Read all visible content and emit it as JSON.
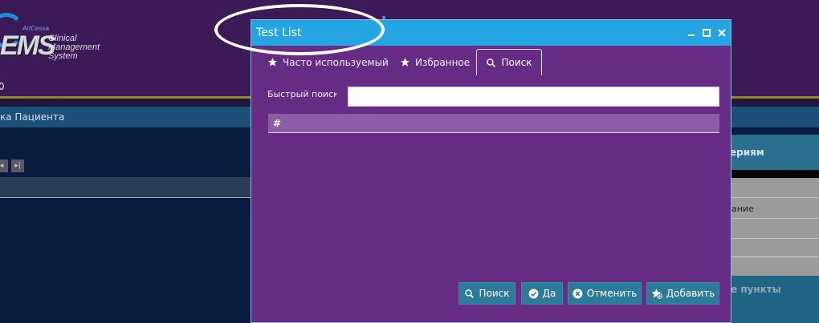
{
  "app": {
    "logo_mark": "EMS",
    "logo_brand": "ArtCessa",
    "logo_lines": [
      "Clinical",
      "Management",
      "System"
    ],
    "version_fragment": "0",
    "left_tab_label": "ка Пациента",
    "right_panel_label": "ериям",
    "right_list_item": "ание",
    "right_footer_label": "е пункты"
  },
  "dialog": {
    "title": "Test List",
    "tabs": [
      {
        "label": "Часто используемый",
        "icon": "star-icon",
        "active": false
      },
      {
        "label": "Избранное",
        "icon": "star-icon",
        "active": false
      },
      {
        "label": "Поиск",
        "icon": "search-icon",
        "active": true
      }
    ],
    "quick_search_label": "Быстрый поиск",
    "quick_search_value": "",
    "grid_columns": [
      "#"
    ],
    "buttons": {
      "search": "Поиск",
      "yes": "Да",
      "cancel": "Отменить",
      "add": "Добавить"
    }
  },
  "colors": {
    "dialog_bg": "#672d86",
    "titlebar": "#24a4e2",
    "button": "#2d7b9a",
    "grid_header": "#8c5da5"
  }
}
